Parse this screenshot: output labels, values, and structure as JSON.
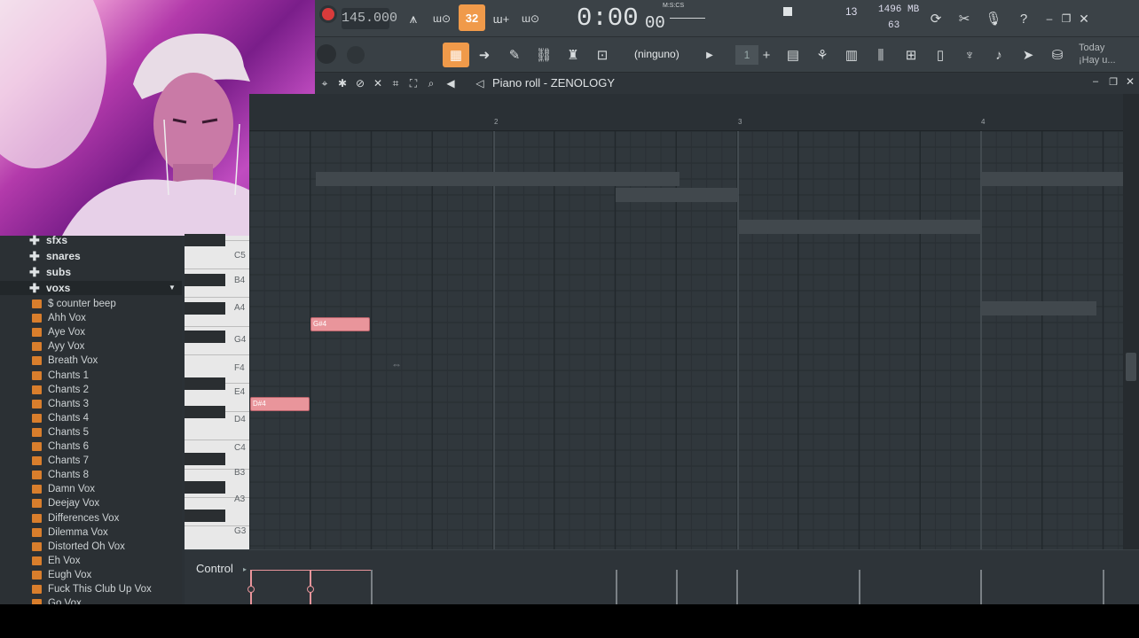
{
  "toolbar": {
    "tempo": "145.000",
    "snap_value": "32",
    "time_main": "0:00",
    "time_sub": "00",
    "time_unit_label": "M:S:CS",
    "cpu_value": "13",
    "memory": "1496 MB",
    "polyphony": "63",
    "help_label": "?",
    "pattern_name": "(ninguno)",
    "pattern_number": "1",
    "hint_line1": "Today",
    "hint_line2": "¡Hay u..."
  },
  "piano_roll": {
    "title": "Piano roll - ZENOLOGY",
    "ruler_numbers": [
      "2",
      "3",
      "4"
    ],
    "notes": [
      {
        "label": "G#4",
        "pitch": "G#4",
        "start_beat": 0.5,
        "length_beats": 0.5
      },
      {
        "label": "D#4",
        "pitch": "D#4",
        "start_beat": 0.0,
        "length_beats": 0.5
      }
    ],
    "key_labels": [
      "C5",
      "B4",
      "A4",
      "G4",
      "F4",
      "E4",
      "D4",
      "C4",
      "B3",
      "A3",
      "G3"
    ]
  },
  "control": {
    "label": "Control"
  },
  "browser": {
    "folders": [
      "sfxs",
      "snares",
      "subs",
      "voxs"
    ],
    "files": [
      "$ counter beep",
      "Ahh Vox",
      "Aye Vox",
      "Ayy Vox",
      "Breath Vox",
      "Chants 1",
      "Chants 2",
      "Chants 3",
      "Chants 4",
      "Chants 5",
      "Chants 6",
      "Chants 7",
      "Chants 8",
      "Damn Vox",
      "Deejay Vox",
      "Differences Vox",
      "Dilemma Vox",
      "Distorted Oh Vox",
      "Eh Vox",
      "Eugh Vox",
      "Fuck This Club Up Vox",
      "Go Vox"
    ]
  },
  "colors": {
    "accent": "#f09a4a",
    "note": "#e9959b",
    "record": "#d93b3b"
  }
}
